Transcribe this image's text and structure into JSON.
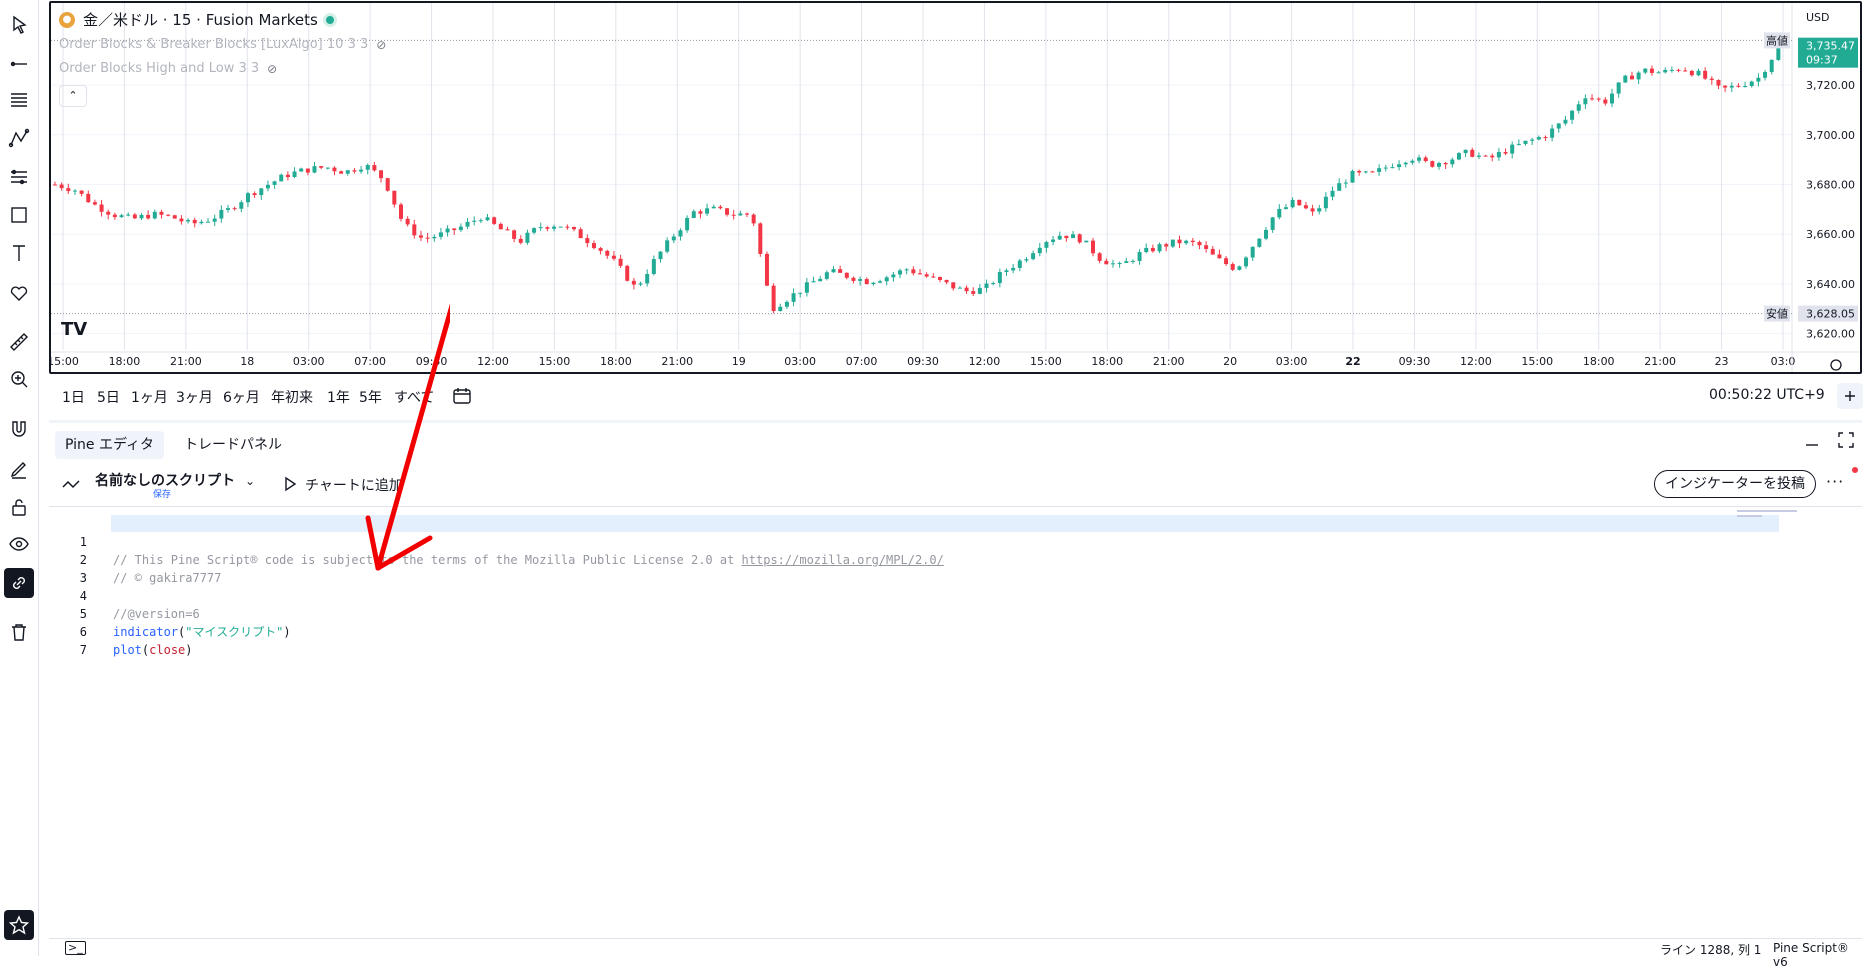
{
  "toolbar": {
    "tools": [
      {
        "name": "cursor-icon",
        "active": false
      },
      {
        "name": "trend-line-icon",
        "active": false
      },
      {
        "name": "fib-retracement-icon",
        "active": false
      },
      {
        "name": "pattern-icon",
        "active": false
      },
      {
        "name": "prediction-icon",
        "active": false
      },
      {
        "name": "geometric-shapes-icon",
        "active": false
      },
      {
        "name": "text-icon",
        "active": false
      },
      {
        "name": "heart-icon",
        "active": false
      },
      {
        "name": "ruler-icon",
        "active": false
      },
      {
        "name": "zoom-in-icon",
        "active": false
      },
      {
        "name": "magnet-icon",
        "active": false
      },
      {
        "name": "draw-mode-icon",
        "active": false
      },
      {
        "name": "lock-icon",
        "active": false
      },
      {
        "name": "eye-icon",
        "active": false
      },
      {
        "name": "link-icon",
        "active": true
      },
      {
        "name": "trash-icon",
        "active": false
      }
    ],
    "bottom_tool": "star-icon"
  },
  "chart": {
    "symbol": "金／米ドル · 15 · Fusion Markets",
    "indicator1": "Order Blocks & Breaker Blocks [LuxAlgo] 10 3 3",
    "indicator2": "Order Blocks High and Low 3 3",
    "currency": "USD",
    "high_label": "高値",
    "low_label": "安値",
    "last_price": "3,735.47",
    "countdown": "09:37",
    "low_price": "3,628.05",
    "price_ticks": [
      "3,720.00",
      "3,700.00",
      "3,680.00",
      "3,660.00",
      "3,640.00",
      "3,620.00"
    ],
    "time_ticks": [
      "15:00",
      "18:00",
      "21:00",
      "18",
      "03:00",
      "07:00",
      "09:30",
      "12:00",
      "15:00",
      "18:00",
      "21:00",
      "19",
      "03:00",
      "07:00",
      "09:30",
      "12:00",
      "15:00",
      "18:00",
      "21:00",
      "20",
      "03:00",
      "22",
      "09:30",
      "12:00",
      "15:00",
      "18:00",
      "21:00",
      "23",
      "03:0"
    ],
    "colors": {
      "up": "#22ab94",
      "down": "#f23645",
      "grid": "#e0e3eb"
    }
  },
  "chart_data": {
    "type": "candlestick",
    "ylim": [
      3615,
      3745
    ],
    "close_path": [
      3680,
      3678,
      3672,
      3668,
      3666,
      3668,
      3667,
      3664,
      3666,
      3670,
      3676,
      3680,
      3684,
      3686,
      3687,
      3685,
      3688,
      3682,
      3664,
      3658,
      3660,
      3663,
      3667,
      3662,
      3657,
      3663,
      3664,
      3660,
      3655,
      3648,
      3638,
      3650,
      3660,
      3669,
      3670,
      3668,
      3668,
      3630,
      3635,
      3640,
      3645,
      3643,
      3641,
      3643,
      3646,
      3643,
      3640,
      3637,
      3638,
      3645,
      3650,
      3657,
      3660,
      3658,
      3650,
      3647,
      3652,
      3655,
      3657,
      3656,
      3650,
      3646,
      3657,
      3668,
      3673,
      3668,
      3678,
      3684,
      3684,
      3688,
      3691,
      3688,
      3690,
      3693,
      3690,
      3694,
      3697,
      3700,
      3706,
      3716,
      3713,
      3722,
      3726,
      3725,
      3727,
      3724,
      3718,
      3720,
      3723,
      3735
    ]
  },
  "range_bar": {
    "buttons": [
      "1日",
      "5日",
      "1ヶ月",
      "3ヶ月",
      "6ヶ月",
      "年初来",
      "1年",
      "5年",
      "すべて"
    ],
    "clock": "00:50:22 UTC+9"
  },
  "panel": {
    "tabs": [
      "Pine エディタ",
      "トレードパネル"
    ],
    "script_name": "名前なしのスクリプト",
    "save_label": "保存",
    "add_to_chart": "チャートに追加",
    "publish": "インジケーターを投稿"
  },
  "code": {
    "line_numbers": [
      "1",
      "2",
      "3",
      "4",
      "5",
      "6",
      "7"
    ],
    "l1": "// This Pine Script® code is subject to the terms of the Mozilla Public License 2.0 at ",
    "l1_url": "https://mozilla.org/MPL/2.0/",
    "l2": "// © gakira7777",
    "l4": "//@version=6",
    "l5_fn": "indicator",
    "l5_open": "(",
    "l5_str": "\"マイスクリプト\"",
    "l5_close": ")",
    "l6_fn": "plot",
    "l6_open": "(",
    "l6_arg": "close",
    "l6_close": ")"
  },
  "status": {
    "position": "ライン 1288, 列 1",
    "version": "Pine Script® v6"
  }
}
